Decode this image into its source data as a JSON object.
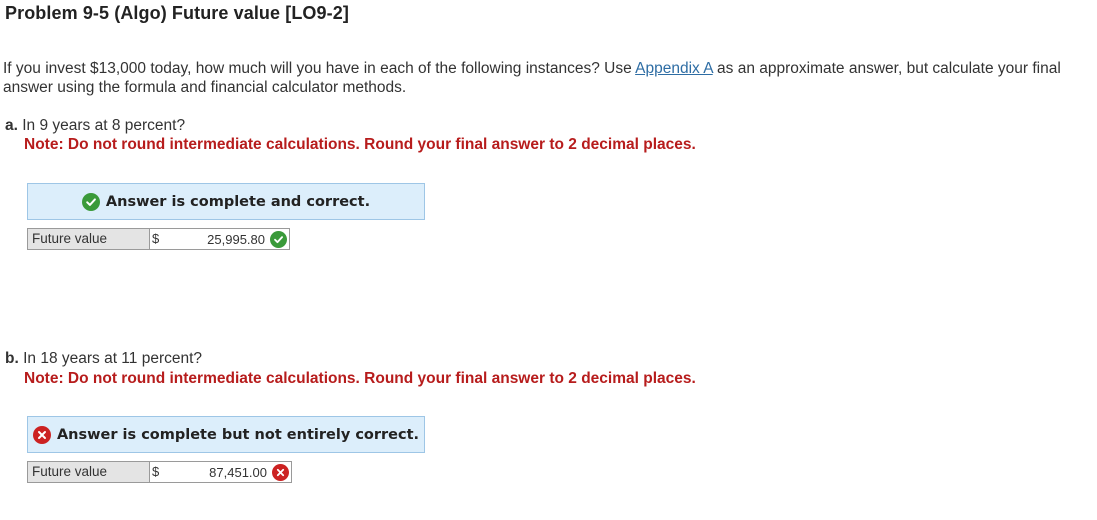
{
  "title": "Problem 9-5 (Algo) Future value [LO9-2]",
  "intro": {
    "before_link": "If you invest $13,000 today, how much will you have in each of the following instances? Use ",
    "link": "Appendix A",
    "after_link": " as an approximate answer, but calculate your final answer using the formula and financial calculator methods."
  },
  "parts": [
    {
      "letter": "a.",
      "question": " In 9 years at 8 percent?",
      "note": "Note: Do not round intermediate calculations. Round your final answer to 2 decimal places.",
      "banner": "Answer is complete and correct.",
      "status": "correct",
      "field_label": "Future value",
      "currency": "$",
      "value": "25,995.80"
    },
    {
      "letter": "b.",
      "question": " In 18 years at 11 percent?",
      "note": "Note: Do not round intermediate calculations. Round your final answer to 2 decimal places.",
      "banner": "Answer is complete but not entirely correct.",
      "status": "incorrect",
      "field_label": "Future value",
      "currency": "$",
      "value": "87,451.00"
    }
  ],
  "colors": {
    "correct": "#3a9a3a",
    "incorrect": "#cc2222",
    "note": "#b71c1c",
    "link": "#2e6da4",
    "banner_bg": "#dceefb"
  }
}
